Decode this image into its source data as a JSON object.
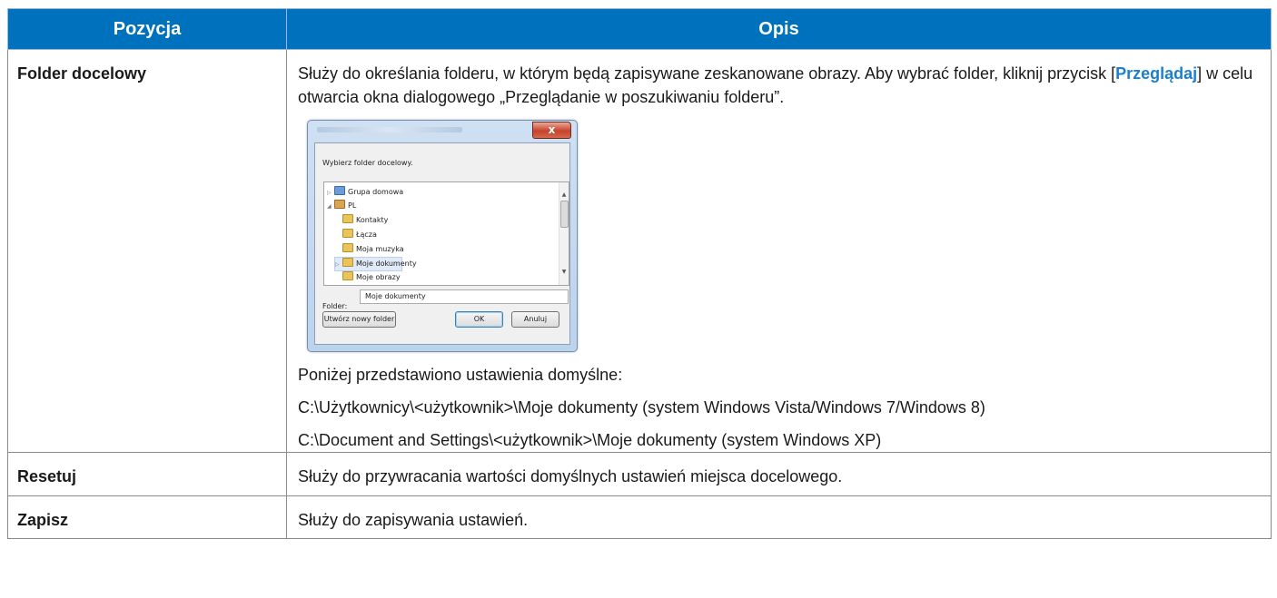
{
  "table": {
    "header": {
      "col1": "Pozycja",
      "col2": "Opis"
    },
    "rows": [
      {
        "key": "Folder docelowy",
        "desc_before": "Służy do określania folderu, w którym będą zapisywane zeskanowane obrazy. Aby wybrać folder, kliknij przycisk [",
        "desc_highlight": "Przeglądaj",
        "desc_after": "] w celu otwarcia okna dialogowego „Przeglądanie w poszukiwaniu folderu”.",
        "defaults_intro": "Poniżej przedstawiono ustawienia domyślne:",
        "default_1": "C:\\Użytkownicy\\<użytkownik>\\Moje dokumenty (system Windows Vista/Windows 7/Windows 8)",
        "default_2": "C:\\Document and Settings\\<użytkownik>\\Moje dokumenty (system Windows XP)"
      },
      {
        "key": "Resetuj",
        "desc": "Służy do przywracania wartości domyślnych ustawień miejsca docelowego."
      },
      {
        "key": "Zapisz",
        "desc": "Służy do zapisywania ustawień."
      }
    ]
  },
  "dialog": {
    "close_glyph": "x",
    "prompt": "Wybierz folder docelowy.",
    "tree": [
      {
        "label": "Grupa domowa",
        "icon": "homegroup-icon"
      },
      {
        "label": "PL",
        "icon": "user-folder-icon"
      },
      {
        "label": "Kontakty",
        "icon": "contacts-folder-icon"
      },
      {
        "label": "Łącza",
        "icon": "links-folder-icon"
      },
      {
        "label": "Moja muzyka",
        "icon": "music-folder-icon"
      },
      {
        "label": "Moje dokumenty",
        "icon": "documents-folder-icon",
        "selected": true
      },
      {
        "label": "Moje obrazy",
        "icon": "pictures-folder-icon"
      }
    ],
    "folder_label": "Folder:",
    "folder_value": "Moje dokumenty",
    "new_folder_button": "Utwórz nowy folder",
    "ok_button": "OK",
    "cancel_button": "Anuluj"
  },
  "colors": {
    "header_bg": "#0071bc",
    "highlight": "#1a7fd0"
  }
}
